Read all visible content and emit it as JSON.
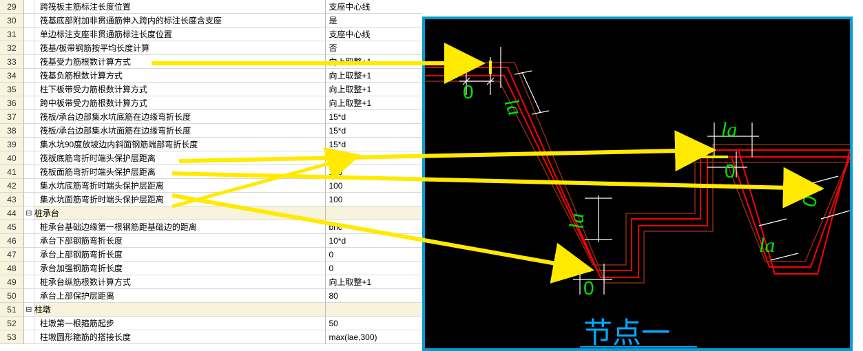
{
  "cad": {
    "title": "节点一",
    "labels": {
      "la": "la",
      "zero": "0"
    }
  },
  "arrows": {
    "color": "#ffea00"
  },
  "rows": [
    {
      "n": "29",
      "tree": "",
      "label": "跨筏板主筋标注长度位置",
      "value": "支座中心线"
    },
    {
      "n": "30",
      "tree": "",
      "label": "筏基底部附加非贯通筋伸入跨内的标注长度含支座",
      "value": "是"
    },
    {
      "n": "31",
      "tree": "",
      "label": "单边标注支座非贯通筋标注长度位置",
      "value": "支座中心线"
    },
    {
      "n": "32",
      "tree": "",
      "label": "筏基/板带钢筋按平均长度计算",
      "value": "否"
    },
    {
      "n": "33",
      "tree": "",
      "label": "筏基受力筋根数计算方式",
      "value": "向上取整+1"
    },
    {
      "n": "34",
      "tree": "",
      "label": "筏基负筋根数计算方式",
      "value": "向上取整+1"
    },
    {
      "n": "35",
      "tree": "",
      "label": "柱下板带受力筋根数计算方式",
      "value": "向上取整+1"
    },
    {
      "n": "36",
      "tree": "",
      "label": "跨中板带受力筋根数计算方式",
      "value": "向上取整+1"
    },
    {
      "n": "37",
      "tree": "",
      "label": "筏板/承台边部集水坑底筋在边缘弯折长度",
      "value": "15*d"
    },
    {
      "n": "38",
      "tree": "",
      "label": "筏板/承台边部集水坑面筋在边缘弯折长度",
      "value": "15*d"
    },
    {
      "n": "39",
      "tree": "",
      "label": "集水坑90度放坡边内斜面钢筋端部弯折长度",
      "value": "15*d"
    },
    {
      "n": "40",
      "tree": "",
      "label": "筏板底筋弯折时端头保护层距离",
      "value": "100"
    },
    {
      "n": "41",
      "tree": "",
      "label": "筏板面筋弯折时端头保护层距离",
      "value": "100"
    },
    {
      "n": "42",
      "tree": "",
      "label": "集水坑底筋弯折时端头保护层距离",
      "value": "100"
    },
    {
      "n": "43",
      "tree": "",
      "label": "集水坑面筋弯折时端头保护层距离",
      "value": "100"
    },
    {
      "n": "44",
      "tree": "⊟",
      "label": "桩承台",
      "value": "",
      "group": true
    },
    {
      "n": "45",
      "tree": "",
      "label": "桩承台基础边缘第一根钢筋距基础边的距离",
      "value": "bhc"
    },
    {
      "n": "46",
      "tree": "",
      "label": "承台下部钢筋弯折长度",
      "value": "10*d"
    },
    {
      "n": "47",
      "tree": "",
      "label": "承台上部钢筋弯折长度",
      "value": "0"
    },
    {
      "n": "48",
      "tree": "",
      "label": "承台加强钢筋弯折长度",
      "value": "0"
    },
    {
      "n": "49",
      "tree": "",
      "label": "桩承台纵筋根数计算方式",
      "value": "向上取整+1"
    },
    {
      "n": "50",
      "tree": "",
      "label": "承台上部保护层距离",
      "value": "80"
    },
    {
      "n": "51",
      "tree": "⊟",
      "label": "柱墩",
      "value": "",
      "group": true
    },
    {
      "n": "52",
      "tree": "",
      "label": "柱墩第一根箍筋起步",
      "value": "50"
    },
    {
      "n": "53",
      "tree": "",
      "label": "柱墩圆形箍筋的搭接长度",
      "value": "max(lae,300)"
    }
  ]
}
